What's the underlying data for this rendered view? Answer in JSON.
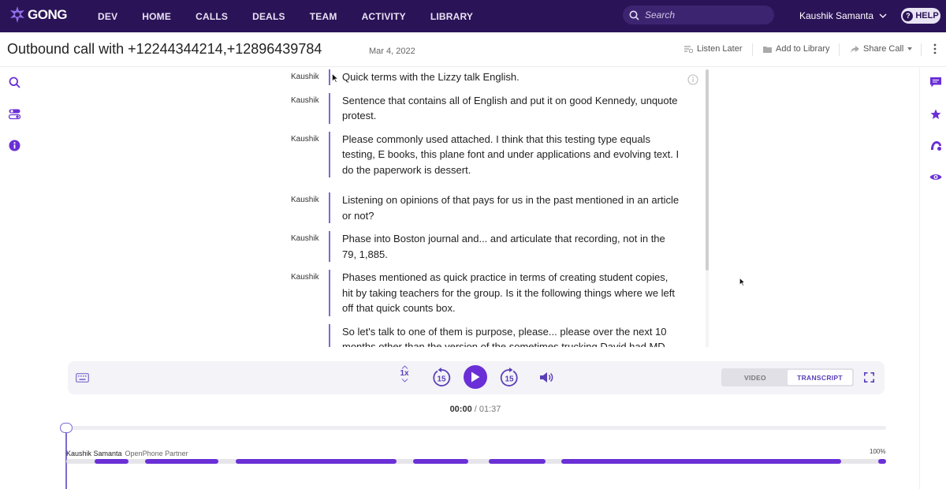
{
  "app": {
    "brand": "GONG",
    "nav": [
      "DEV",
      "HOME",
      "CALLS",
      "DEALS",
      "TEAM",
      "ACTIVITY",
      "LIBRARY"
    ],
    "search_placeholder": "Search",
    "user_name": "Kaushik Samanta",
    "help_label": "HELP"
  },
  "header": {
    "title": "Outbound call with +12244344214,+12896439784",
    "date": "Mar 4, 2022",
    "listen_later": "Listen Later",
    "add_to_library": "Add to Library",
    "share_call": "Share Call"
  },
  "transcript": [
    {
      "speaker": "Kaushik",
      "text": "Quick terms with the Lizzy talk English."
    },
    {
      "speaker": "Kaushik",
      "text": "Sentence that contains all of English and put it on good Kennedy, unquote protest."
    },
    {
      "speaker": "Kaushik",
      "text": "Please commonly used attached. I think that this testing type equals testing, E books, this plane font and under applications and evolving text. I do the paperwork is dessert."
    },
    {
      "speaker": "Kaushik",
      "text": "Listening on opinions of that pays for us in the past mentioned in an article or not?"
    },
    {
      "speaker": "Kaushik",
      "text": "Phase into Boston journal and... and articulate that recording, not in the 79, 1,885."
    },
    {
      "speaker": "Kaushik",
      "text": "Phases mentioned as quick practice in terms of creating student copies, hit by taking teachers for the group. Is it the following things where we left off that quick counts box."
    },
    {
      "speaker": "",
      "text": "So let's talk to one of them is purpose, please... please over the next 10 months other than the version of the sometimes trucking David had MD"
    }
  ],
  "player": {
    "speed": "1x",
    "skip_back": "15",
    "skip_forward": "15",
    "view_video": "VIDEO",
    "view_transcript": "TRANSCRIPT",
    "active_view": "TRANSCRIPT",
    "current_time": "00:00",
    "total_time": "01:37",
    "progress": 0
  },
  "timeline": {
    "speaker": "Kaushik Samanta",
    "speaker_sub": "OpenPhone Partner",
    "percent_label": "100%",
    "talk_segments": [
      [
        0.035,
        0.076
      ],
      [
        0.096,
        0.185
      ],
      [
        0.207,
        0.403
      ],
      [
        0.423,
        0.49
      ],
      [
        0.515,
        0.584
      ],
      [
        0.604,
        0.945
      ],
      [
        0.99,
        1.0
      ]
    ]
  },
  "colors": {
    "nav_bg": "#2b1357",
    "accent": "#6a2fd6",
    "speaker_bar": "#7a6bd1"
  },
  "icons": {
    "left_rail": [
      "search-icon",
      "toggle-settings-icon",
      "info-icon"
    ],
    "right_rail": [
      "comment-icon",
      "star-icon",
      "activity-icon",
      "eye-icon"
    ]
  }
}
